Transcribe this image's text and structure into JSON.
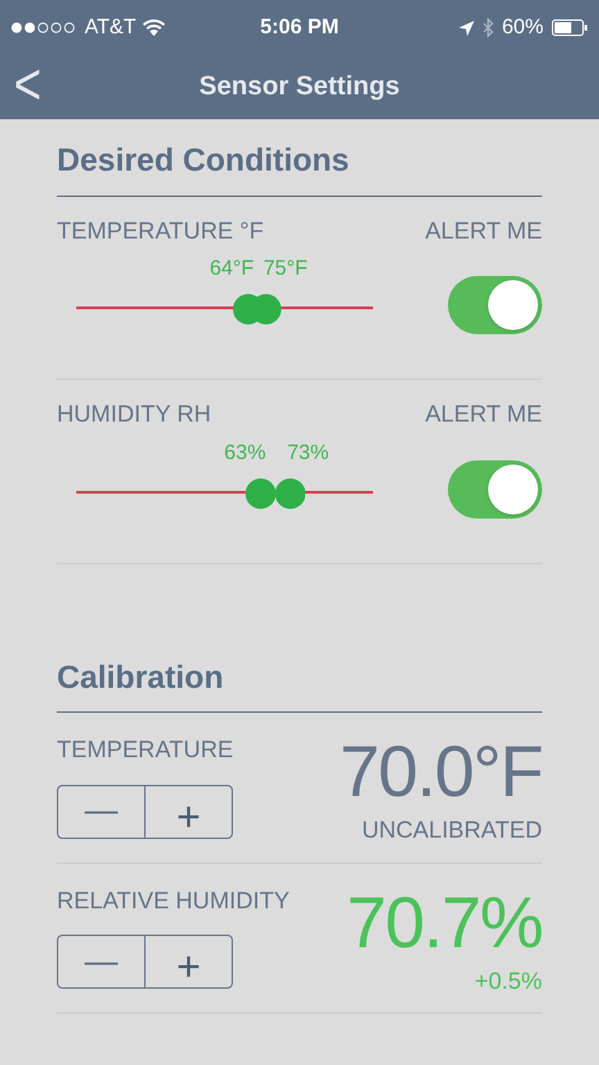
{
  "status_bar": {
    "carrier": "AT&T",
    "time": "5:06 PM",
    "battery": "60%"
  },
  "nav": {
    "back": "<",
    "title": "Sensor Settings"
  },
  "desired": {
    "title": "Desired Conditions",
    "rows": [
      {
        "label": "TEMPERATURE °F",
        "alert_label": "ALERT ME",
        "alert_on": true,
        "low": "64°F",
        "high": "75°F"
      },
      {
        "label": "HUMIDITY RH",
        "alert_label": "ALERT ME",
        "alert_on": true,
        "low": "63%",
        "high": "73%"
      }
    ]
  },
  "calibration": {
    "title": "Calibration",
    "rows": [
      {
        "label": "TEMPERATURE",
        "minus": "—",
        "plus": "+",
        "reading": "70.0°F",
        "note": "UNCALIBRATED",
        "kind": "uncalibrated"
      },
      {
        "label": "RELATIVE HUMIDITY",
        "minus": "—",
        "plus": "+",
        "reading": "70.7%",
        "note": "+0.5%",
        "kind": "offset"
      }
    ]
  }
}
